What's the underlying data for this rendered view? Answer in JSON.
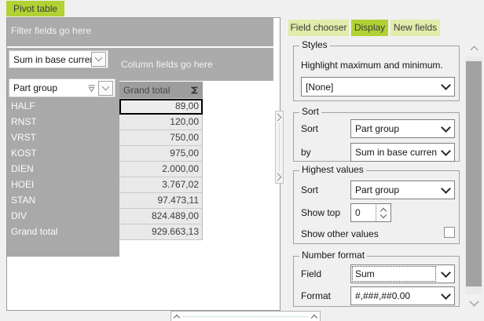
{
  "app": {
    "tab_label": "Pivot table"
  },
  "right_tabs": [
    {
      "label": "Field chooser",
      "active": false
    },
    {
      "label": "Display",
      "active": true
    },
    {
      "label": "New fields",
      "active": false
    }
  ],
  "pivot": {
    "filter_hint": "Filter fields go here",
    "column_hint": "Column fields go here",
    "measure_field": "Sum in base currency",
    "row_field": "Part group",
    "value_column_header": "Grand total",
    "selected_row_index": 0,
    "rows": [
      {
        "label": "HALF",
        "value": "89,00"
      },
      {
        "label": "RNST",
        "value": "120,00"
      },
      {
        "label": "VRST",
        "value": "750,00"
      },
      {
        "label": "KOST",
        "value": "975,00"
      },
      {
        "label": "DIEN",
        "value": "2.000,00"
      },
      {
        "label": "HOEI",
        "value": "3.767,02"
      },
      {
        "label": "STAN",
        "value": "97.473,11"
      },
      {
        "label": "DIV",
        "value": "824.489,00"
      },
      {
        "label": "Grand total",
        "value": "929.663,13",
        "is_total": true
      }
    ]
  },
  "settings": {
    "styles": {
      "legend": "Styles",
      "description": "Highlight maximum and minimum.",
      "selected": "[None]"
    },
    "sort": {
      "legend": "Sort",
      "sort_label": "Sort",
      "sort_value": "Part group",
      "by_label": "by",
      "by_value": "Sum in base currency"
    },
    "highest_values": {
      "legend": "Highest values",
      "sort_label": "Sort",
      "sort_value": "Part group",
      "show_top_label": "Show top",
      "show_top_value": "0",
      "show_other_label": "Show other values",
      "show_other_checked": false
    },
    "number_format": {
      "legend": "Number format",
      "field_label": "Field",
      "field_value": "Sum",
      "format_label": "Format",
      "format_value": "#,###,##0.00"
    }
  },
  "colors": {
    "accent_green": "#b1d235",
    "inactive_tab_green": "#e2ecab",
    "header_gray": "#ababab",
    "value_header_gray": "#9d9d9d",
    "cell_gray": "#e9e9e9"
  }
}
